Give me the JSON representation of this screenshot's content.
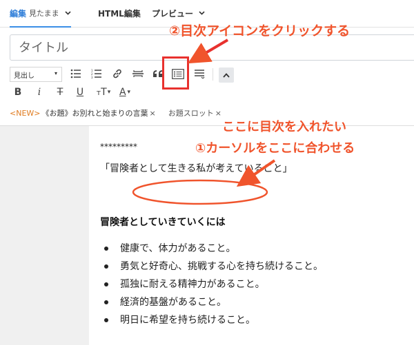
{
  "tabs": {
    "edit_label": "編集",
    "edit_mode": "見たまま",
    "html_label": "HTML編集",
    "preview_label": "プレビュー"
  },
  "title_placeholder": "タイトル",
  "toolbar": {
    "heading_select": "見出し",
    "icons": [
      "bulleted-list",
      "numbered-list",
      "link",
      "horizontal-rule",
      "quote",
      "table-of-contents",
      "more",
      "collapse",
      "bold",
      "italic",
      "strikethrough",
      "underline",
      "font-size",
      "text-color"
    ]
  },
  "topic_bar": {
    "new_tag": "<NEW>",
    "topic_text": "《お題》お別れと始まりの言葉",
    "close": "×",
    "slot_label": "お題スロット",
    "slot_close": "×"
  },
  "editor": {
    "stars": "*********",
    "quote": "「冒険者として生きる私が考えていること」",
    "heading": "冒険者としていきていくには",
    "bullets": [
      "健康で、体力があること。",
      "勇気と好奇心、挑戦する心を持ち続けること。",
      "孤独に耐える精神力があること。",
      "経済的基盤があること。",
      "明日に希望を持ち続けること。"
    ]
  },
  "annotations": {
    "step2": "②目次アイコンをクリックする",
    "want_toc": "ここに目次を入れたい",
    "step1": "①カーソルをここに合わせる",
    "color": "#f0542c"
  }
}
